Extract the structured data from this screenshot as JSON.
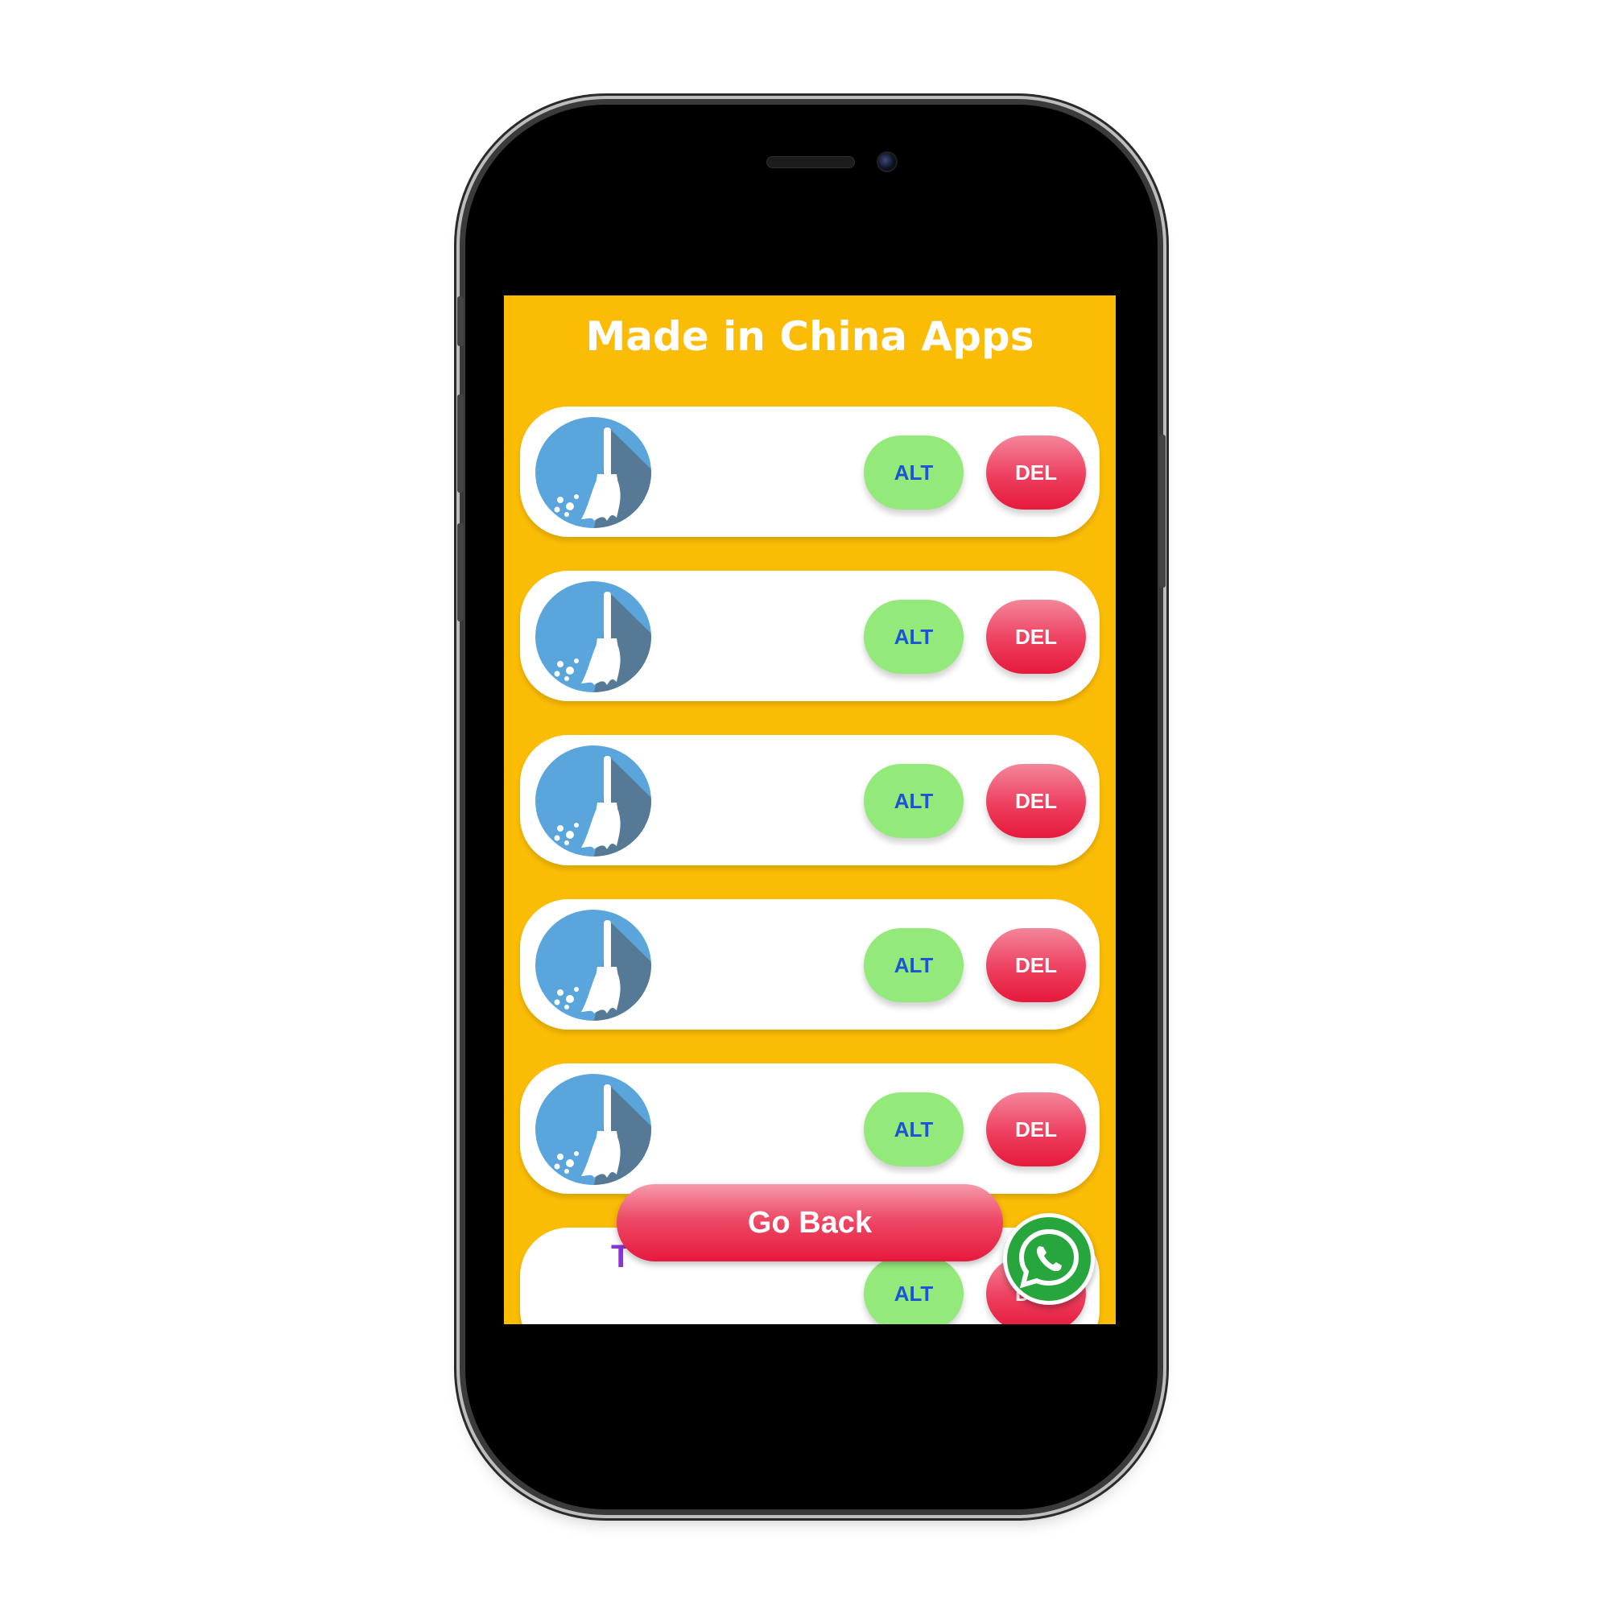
{
  "screen": {
    "title": "Made in China Apps",
    "apps": [
      {
        "icon": "broom-icon",
        "alt_label": "ALT",
        "del_label": "DEL"
      },
      {
        "icon": "broom-icon",
        "alt_label": "ALT",
        "del_label": "DEL"
      },
      {
        "icon": "broom-icon",
        "alt_label": "ALT",
        "del_label": "DEL"
      },
      {
        "icon": "broom-icon",
        "alt_label": "ALT",
        "del_label": "DEL"
      },
      {
        "icon": "broom-icon",
        "alt_label": "ALT",
        "del_label": "DEL"
      },
      {
        "icon": "partial-app-icon",
        "alt_label": "ALT",
        "del_label": "DEL"
      }
    ],
    "go_back_label": "Go Back",
    "chat_button_icon": "whatsapp-icon"
  },
  "colors": {
    "background": "#fbbc05",
    "alt_button": "#93ea7b",
    "alt_text": "#1a53d6",
    "del_button": "#e6193d",
    "whatsapp": "#26a63c"
  }
}
